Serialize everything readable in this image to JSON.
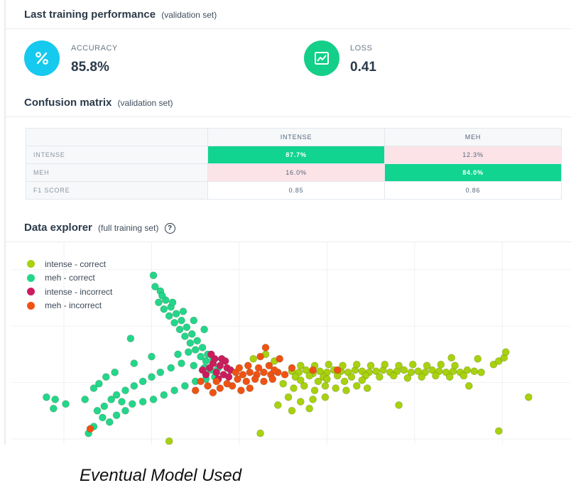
{
  "performance": {
    "title": "Last training performance",
    "subtitle": "(validation set)",
    "accuracy": {
      "label": "ACCURACY",
      "value": "85.8%",
      "icon": "percent-icon",
      "color": "#16c9ee"
    },
    "loss": {
      "label": "LOSS",
      "value": "0.41",
      "icon": "chart-icon",
      "color": "#14cf88"
    }
  },
  "confusion": {
    "title": "Confusion matrix",
    "subtitle": "(validation set)",
    "columns": [
      "INTENSE",
      "MEH"
    ],
    "rows": [
      {
        "label": "INTENSE",
        "cells": [
          "87.7%",
          "12.3%"
        ]
      },
      {
        "label": "MEH",
        "cells": [
          "16.0%",
          "84.0%"
        ]
      },
      {
        "label": "F1 SCORE",
        "cells": [
          "0.85",
          "0.86"
        ]
      }
    ],
    "colors": {
      "good": "#10d48f",
      "bad": "#fbe3e8"
    }
  },
  "explorer": {
    "title": "Data explorer",
    "subtitle": "(full training set)",
    "help_icon": "question-circle-icon",
    "legend": [
      {
        "label": "intense - correct",
        "color": "#a8d10e"
      },
      {
        "label": "meh - correct",
        "color": "#23d68a"
      },
      {
        "label": "intense - incorrect",
        "color": "#cc1c5e"
      },
      {
        "label": "meh - incorrect",
        "color": "#f05214"
      }
    ]
  },
  "chart_data": {
    "type": "scatter",
    "series": [
      {
        "name": "intense - correct",
        "color": "#a8d10e",
        "points": [
          [
            0.6,
            0.35
          ],
          [
            0.68,
            0.34
          ],
          [
            0.76,
            0.36
          ],
          [
            0.84,
            0.33
          ],
          [
            0.92,
            0.35
          ],
          [
            1.0,
            0.34
          ],
          [
            1.08,
            0.36
          ],
          [
            1.16,
            0.35
          ],
          [
            1.24,
            0.34
          ],
          [
            1.32,
            0.36
          ],
          [
            1.4,
            0.35
          ],
          [
            1.48,
            0.34
          ],
          [
            1.56,
            0.35
          ],
          [
            1.64,
            0.36
          ],
          [
            1.72,
            0.34
          ],
          [
            1.8,
            0.35
          ],
          [
            1.88,
            0.36
          ],
          [
            1.96,
            0.34
          ],
          [
            2.04,
            0.35
          ],
          [
            2.12,
            0.34
          ],
          [
            2.2,
            0.36
          ],
          [
            2.28,
            0.35
          ],
          [
            2.36,
            0.34
          ],
          [
            2.44,
            0.35
          ],
          [
            2.52,
            0.34
          ],
          [
            2.6,
            0.36
          ],
          [
            2.68,
            0.35
          ],
          [
            2.76,
            0.34
          ],
          [
            0.64,
            0.3
          ],
          [
            0.8,
            0.31
          ],
          [
            0.96,
            0.3
          ],
          [
            1.12,
            0.31
          ],
          [
            1.28,
            0.3
          ],
          [
            1.44,
            0.31
          ],
          [
            1.6,
            0.3
          ],
          [
            1.76,
            0.31
          ],
          [
            1.92,
            0.29
          ],
          [
            2.08,
            0.3
          ],
          [
            2.24,
            0.31
          ],
          [
            2.4,
            0.3
          ],
          [
            2.56,
            0.31
          ],
          [
            0.7,
            0.4
          ],
          [
            0.86,
            0.4
          ],
          [
            1.02,
            0.41
          ],
          [
            1.18,
            0.4
          ],
          [
            1.34,
            0.41
          ],
          [
            1.5,
            0.4
          ],
          [
            1.66,
            0.41
          ],
          [
            1.82,
            0.4
          ],
          [
            1.98,
            0.41
          ],
          [
            2.14,
            0.4
          ],
          [
            2.3,
            0.41
          ],
          [
            2.46,
            0.4
          ],
          [
            0.5,
            0.24
          ],
          [
            0.62,
            0.2
          ],
          [
            0.74,
            0.22
          ],
          [
            0.86,
            0.18
          ],
          [
            0.98,
            0.22
          ],
          [
            1.1,
            0.2
          ],
          [
            1.22,
            0.18
          ],
          [
            1.34,
            0.22
          ],
          [
            1.46,
            0.2
          ],
          [
            0.56,
            0.12
          ],
          [
            0.7,
            0.08
          ],
          [
            0.84,
            0.1
          ],
          [
            0.98,
            0.12
          ],
          [
            0.44,
            0.05
          ],
          [
            0.6,
            0.0
          ],
          [
            0.8,
            0.02
          ],
          [
            1.0,
            0.28
          ],
          [
            1.2,
            0.26
          ],
          [
            1.4,
            0.27
          ],
          [
            0.9,
            0.26
          ],
          [
            0.7,
            0.27
          ],
          [
            0.3,
            0.5
          ],
          [
            0.16,
            0.46
          ],
          [
            0.4,
            0.44
          ],
          [
            1.82,
            0.05
          ],
          [
            2.62,
            0.22
          ],
          [
            2.9,
            0.41
          ],
          [
            2.96,
            0.44
          ],
          [
            3.02,
            0.47
          ],
          [
            3.04,
            0.52
          ],
          [
            2.72,
            0.46
          ],
          [
            2.42,
            0.47
          ],
          [
            3.3,
            0.12
          ],
          [
            2.96,
            -0.18
          ],
          [
            0.24,
            -0.2
          ],
          [
            -0.8,
            -0.27
          ]
        ]
      },
      {
        "name": "meh - correct",
        "color": "#23d68a",
        "points": [
          [
            -0.98,
            1.2
          ],
          [
            -0.96,
            1.1
          ],
          [
            -0.9,
            1.06
          ],
          [
            -0.92,
            0.96
          ],
          [
            -0.84,
            0.98
          ],
          [
            -0.86,
            0.9
          ],
          [
            -0.78,
            0.92
          ],
          [
            -0.8,
            0.84
          ],
          [
            -0.72,
            0.86
          ],
          [
            -0.74,
            0.78
          ],
          [
            -0.66,
            0.8
          ],
          [
            -0.68,
            0.72
          ],
          [
            -0.6,
            0.74
          ],
          [
            -0.62,
            0.66
          ],
          [
            -0.54,
            0.68
          ],
          [
            -0.56,
            0.6
          ],
          [
            -0.48,
            0.62
          ],
          [
            -0.5,
            0.54
          ],
          [
            -0.42,
            0.56
          ],
          [
            -0.44,
            0.48
          ],
          [
            -0.36,
            0.5
          ],
          [
            -0.38,
            0.44
          ],
          [
            -0.3,
            0.46
          ],
          [
            -0.88,
            1.02
          ],
          [
            -0.76,
            0.96
          ],
          [
            -0.64,
            0.88
          ],
          [
            -0.52,
            0.8
          ],
          [
            -0.4,
            0.72
          ],
          [
            -0.58,
            0.52
          ],
          [
            -0.7,
            0.5
          ],
          [
            -0.66,
            0.42
          ],
          [
            -0.52,
            0.4
          ],
          [
            -0.4,
            0.38
          ],
          [
            -0.32,
            0.36
          ],
          [
            -0.24,
            0.38
          ],
          [
            -0.78,
            0.38
          ],
          [
            -0.9,
            0.34
          ],
          [
            -1.0,
            0.3
          ],
          [
            -1.1,
            0.26
          ],
          [
            -1.2,
            0.22
          ],
          [
            -1.3,
            0.18
          ],
          [
            -1.4,
            0.14
          ],
          [
            -1.46,
            0.1
          ],
          [
            -1.34,
            0.08
          ],
          [
            -1.22,
            0.06
          ],
          [
            -1.1,
            0.08
          ],
          [
            -0.98,
            0.1
          ],
          [
            -0.86,
            0.14
          ],
          [
            -0.74,
            0.18
          ],
          [
            -0.62,
            0.22
          ],
          [
            -0.5,
            0.26
          ],
          [
            -0.38,
            0.28
          ],
          [
            -0.28,
            0.3
          ],
          [
            -1.54,
            0.04
          ],
          [
            -1.62,
            0.0
          ],
          [
            -1.56,
            -0.06
          ],
          [
            -1.48,
            -0.1
          ],
          [
            -1.4,
            -0.04
          ],
          [
            -1.3,
            0.0
          ],
          [
            -1.66,
            -0.14
          ],
          [
            -1.72,
            -0.2
          ],
          [
            -1.66,
            0.2
          ],
          [
            -1.76,
            0.1
          ],
          [
            -1.52,
            0.3
          ],
          [
            -1.42,
            0.34
          ],
          [
            -1.2,
            0.42
          ],
          [
            -1.0,
            0.48
          ],
          [
            -2.1,
            0.1
          ],
          [
            -2.2,
            0.12
          ],
          [
            -1.98,
            0.06
          ],
          [
            -2.12,
            0.02
          ],
          [
            -1.24,
            0.64
          ],
          [
            -1.6,
            0.24
          ]
        ]
      },
      {
        "name": "intense - incorrect",
        "color": "#cc1c5e",
        "points": [
          [
            -0.3,
            0.42
          ],
          [
            -0.22,
            0.4
          ],
          [
            -0.14,
            0.38
          ],
          [
            -0.26,
            0.34
          ],
          [
            -0.18,
            0.32
          ],
          [
            -0.1,
            0.36
          ],
          [
            -0.34,
            0.38
          ],
          [
            -0.28,
            0.46
          ],
          [
            -0.2,
            0.46
          ],
          [
            -0.38,
            0.32
          ],
          [
            -0.12,
            0.3
          ],
          [
            -0.24,
            0.28
          ],
          [
            -0.42,
            0.36
          ],
          [
            -0.16,
            0.44
          ],
          [
            -0.32,
            0.5
          ]
        ]
      },
      {
        "name": "meh - incorrect",
        "color": "#f05214",
        "points": [
          [
            -0.04,
            0.34
          ],
          [
            0.04,
            0.32
          ],
          [
            0.12,
            0.34
          ],
          [
            0.2,
            0.32
          ],
          [
            0.28,
            0.34
          ],
          [
            0.36,
            0.32
          ],
          [
            0.44,
            0.34
          ],
          [
            0.52,
            0.32
          ],
          [
            -0.02,
            0.28
          ],
          [
            0.08,
            0.26
          ],
          [
            0.18,
            0.28
          ],
          [
            0.28,
            0.26
          ],
          [
            0.38,
            0.28
          ],
          [
            0.0,
            0.38
          ],
          [
            0.1,
            0.4
          ],
          [
            0.22,
            0.38
          ],
          [
            0.34,
            0.4
          ],
          [
            -0.08,
            0.22
          ],
          [
            0.02,
            0.18
          ],
          [
            0.12,
            0.2
          ],
          [
            -0.14,
            0.24
          ],
          [
            -0.22,
            0.2
          ],
          [
            -0.3,
            0.16
          ],
          [
            -0.36,
            0.22
          ],
          [
            -0.44,
            0.26
          ],
          [
            -0.5,
            0.18
          ],
          [
            0.24,
            0.48
          ],
          [
            0.3,
            0.56
          ],
          [
            0.46,
            0.46
          ],
          [
            0.6,
            0.38
          ],
          [
            0.84,
            0.36
          ],
          [
            1.12,
            0.36
          ],
          [
            -1.7,
            -0.16
          ],
          [
            0.4,
            0.36
          ],
          [
            -0.26,
            0.26
          ]
        ]
      }
    ],
    "xlim": [
      -2.6,
      3.8
    ],
    "ylim": [
      -0.3,
      1.5
    ],
    "grid": true,
    "legend_position": "top-left"
  },
  "caption": "Eventual Model Used"
}
